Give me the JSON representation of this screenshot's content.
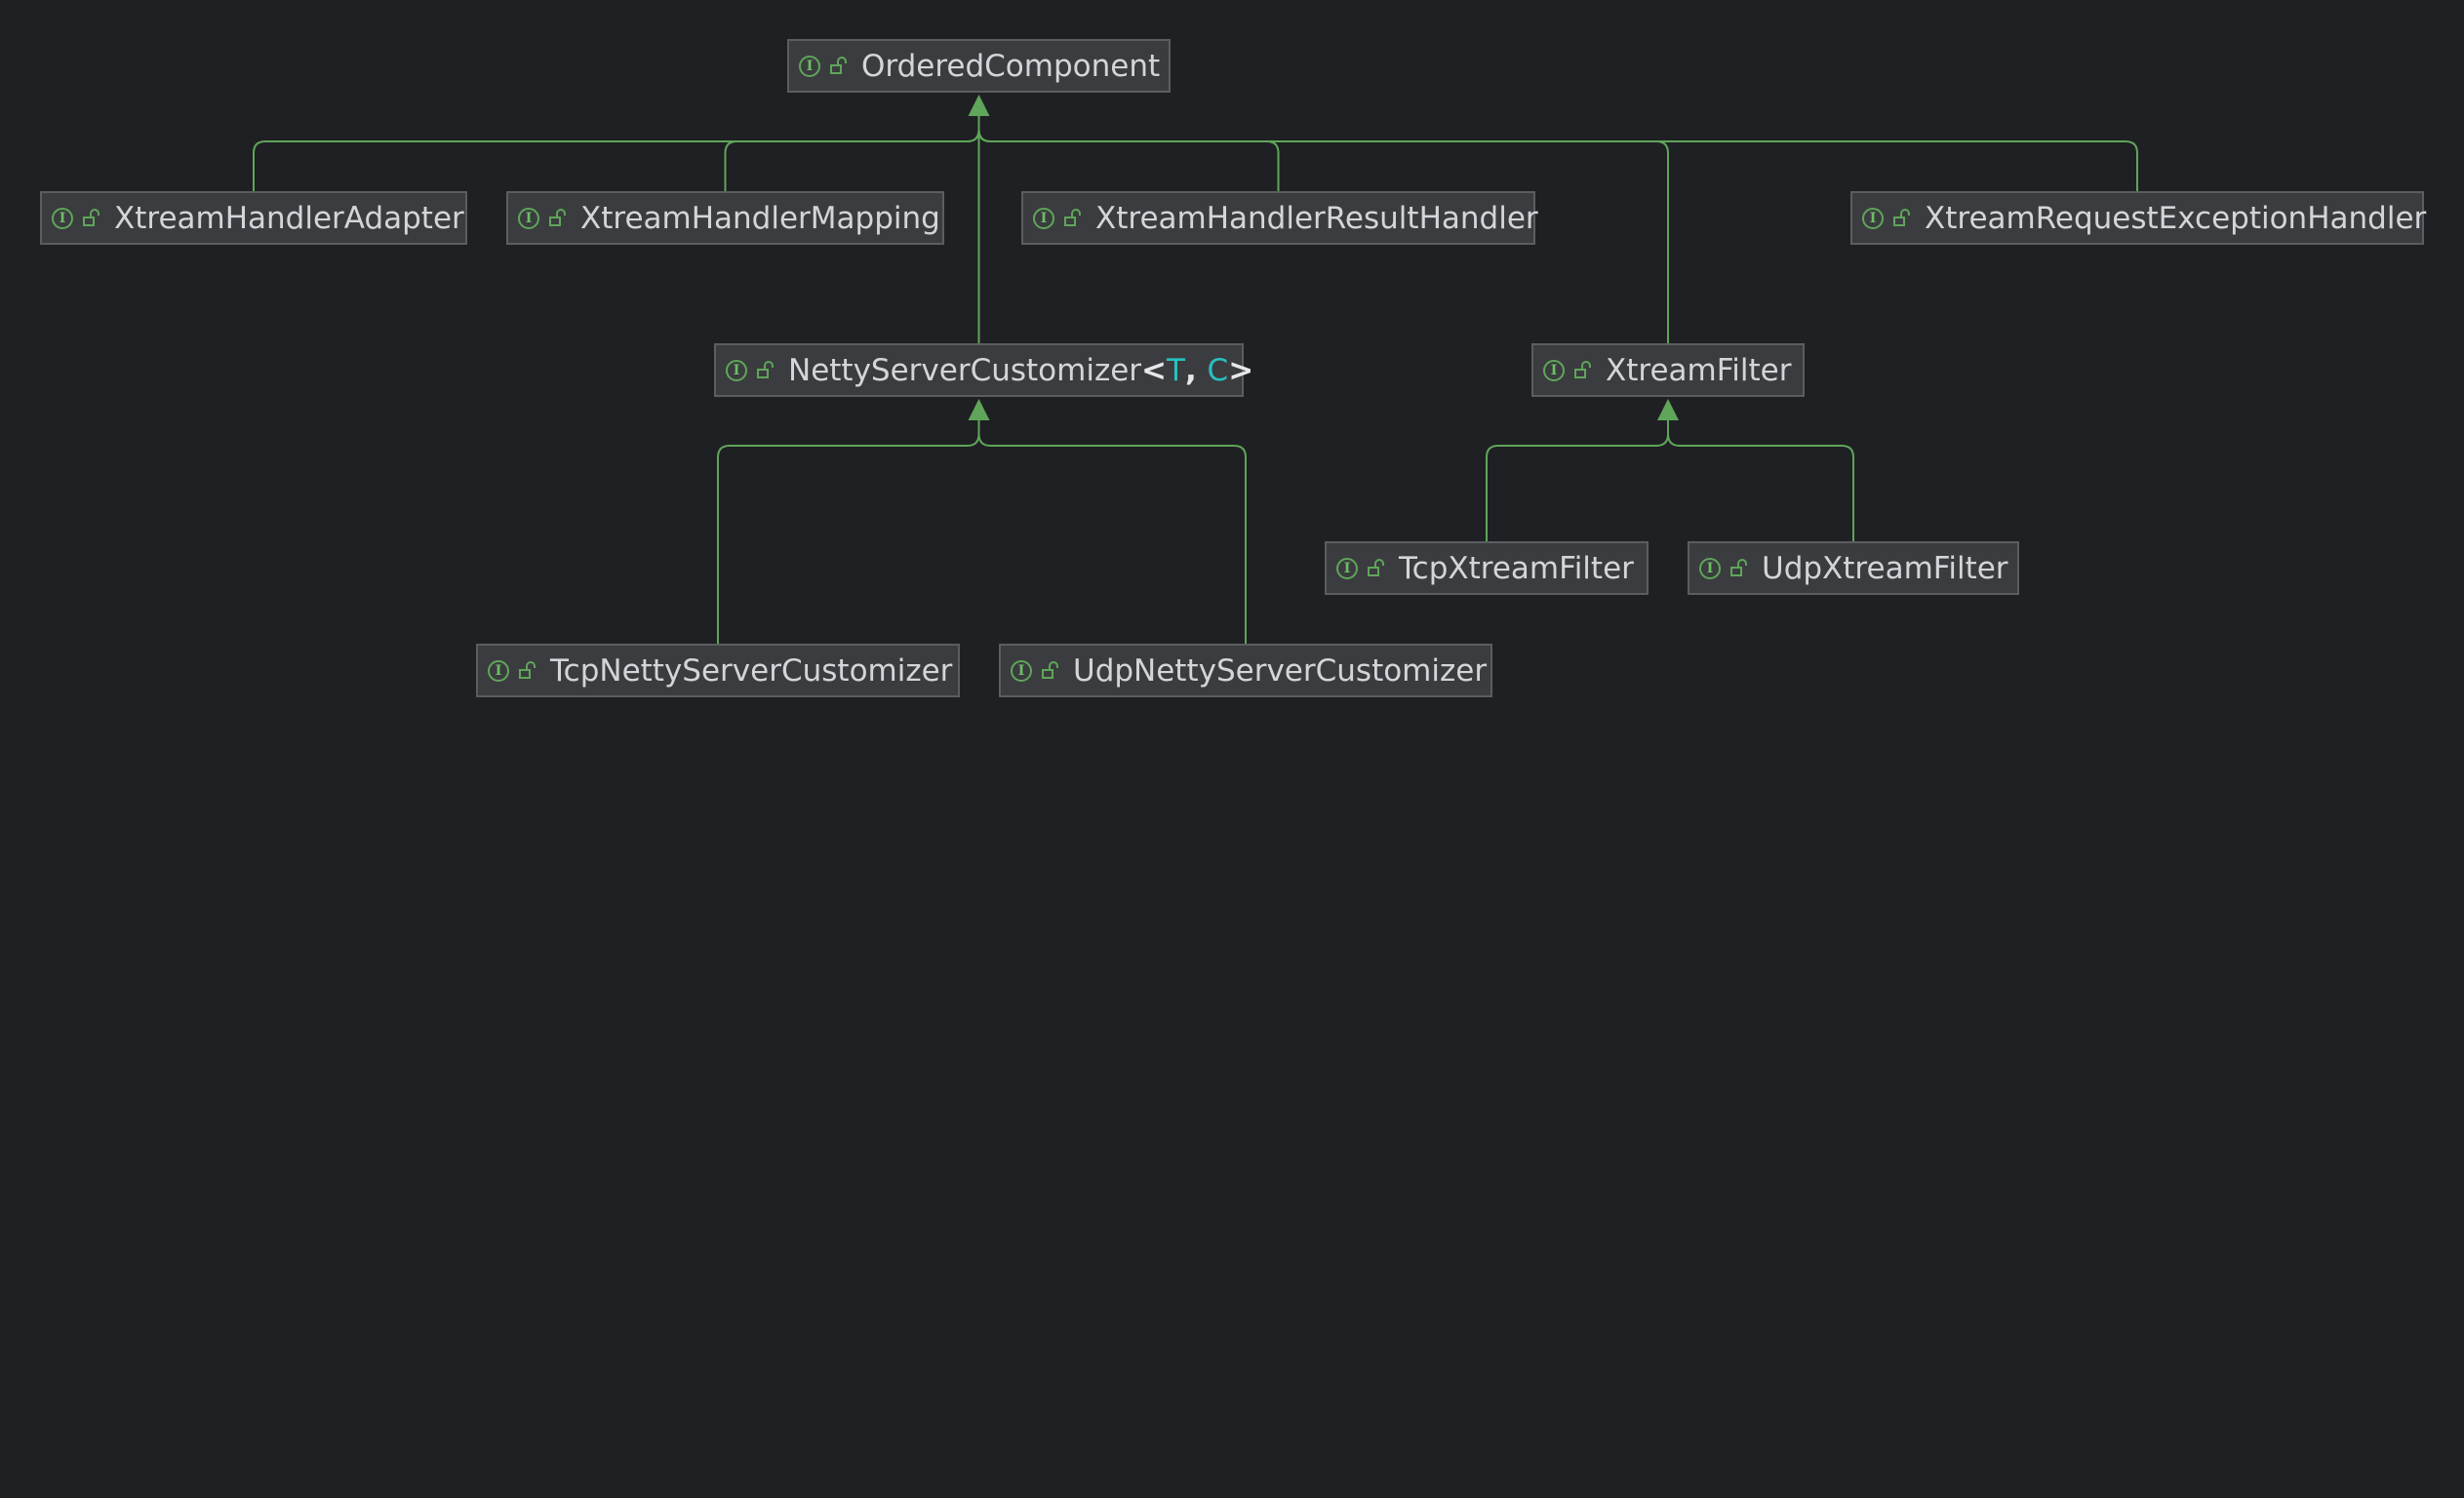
{
  "colors": {
    "background": "#1f2023",
    "node_fill": "#3b3c3f",
    "node_border": "#5b5d61",
    "edge": "#5fa55a",
    "label": "#d3d5d9",
    "type_param": "#27c1c1"
  },
  "nodes": [
    {
      "id": "ordered",
      "kind": "interface",
      "visibility": "public",
      "label": "OrderedComponent"
    },
    {
      "id": "adapter",
      "kind": "interface",
      "visibility": "public",
      "label": "XtreamHandlerAdapter"
    },
    {
      "id": "mapping",
      "kind": "interface",
      "visibility": "public",
      "label": "XtreamHandlerMapping"
    },
    {
      "id": "result",
      "kind": "interface",
      "visibility": "public",
      "label": "XtreamHandlerResultHandler"
    },
    {
      "id": "exception",
      "kind": "interface",
      "visibility": "public",
      "label": "XtreamRequestExceptionHandler"
    },
    {
      "id": "netty",
      "kind": "interface",
      "visibility": "public",
      "label": "NettyServerCustomizer",
      "type_params": [
        "T",
        "C"
      ]
    },
    {
      "id": "filter",
      "kind": "interface",
      "visibility": "public",
      "label": "XtreamFilter"
    },
    {
      "id": "tcpfilter",
      "kind": "interface",
      "visibility": "public",
      "label": "TcpXtreamFilter"
    },
    {
      "id": "udpfilter",
      "kind": "interface",
      "visibility": "public",
      "label": "UdpXtreamFilter"
    },
    {
      "id": "tcpnetty",
      "kind": "interface",
      "visibility": "public",
      "label": "TcpNettyServerCustomizer"
    },
    {
      "id": "udpnetty",
      "kind": "interface",
      "visibility": "public",
      "label": "UdpNettyServerCustomizer"
    }
  ],
  "edges": [
    {
      "from": "adapter",
      "to": "ordered",
      "type": "extends"
    },
    {
      "from": "mapping",
      "to": "ordered",
      "type": "extends"
    },
    {
      "from": "result",
      "to": "ordered",
      "type": "extends"
    },
    {
      "from": "exception",
      "to": "ordered",
      "type": "extends"
    },
    {
      "from": "netty",
      "to": "ordered",
      "type": "extends"
    },
    {
      "from": "filter",
      "to": "ordered",
      "type": "extends"
    },
    {
      "from": "tcpfilter",
      "to": "filter",
      "type": "extends"
    },
    {
      "from": "udpfilter",
      "to": "filter",
      "type": "extends"
    },
    {
      "from": "tcpnetty",
      "to": "netty",
      "type": "extends"
    },
    {
      "from": "udpnetty",
      "to": "netty",
      "type": "extends"
    }
  ]
}
